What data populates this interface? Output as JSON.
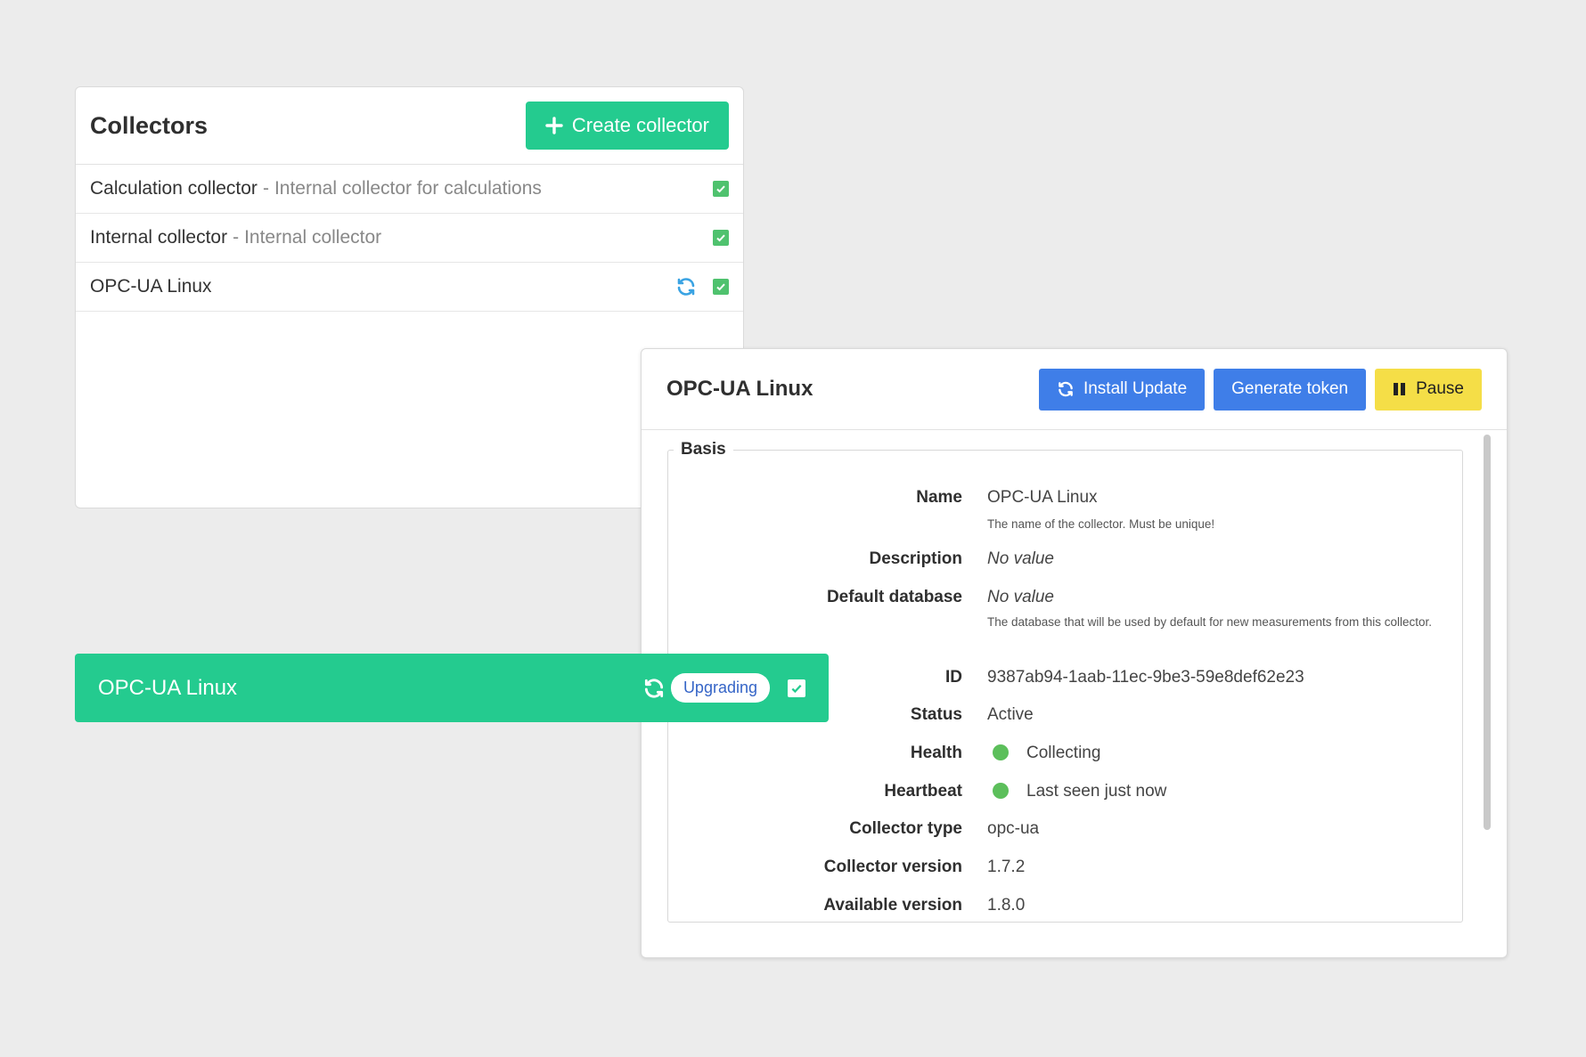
{
  "collectors_panel": {
    "title": "Collectors",
    "create_button": "Create collector",
    "rows": [
      {
        "name": "Calculation collector",
        "separator": "-",
        "description": "Internal collector for calculations"
      },
      {
        "name": "Internal collector",
        "separator": "-",
        "description": "Internal collector"
      },
      {
        "name": "OPC-UA Linux"
      }
    ]
  },
  "detail_panel": {
    "title": "OPC-UA Linux",
    "buttons": {
      "install_update": "Install Update",
      "generate_token": "Generate token",
      "pause": "Pause"
    },
    "section": "Basis",
    "fields": {
      "name": {
        "label": "Name",
        "value": "OPC-UA Linux",
        "help": "The name of the collector. Must be unique!"
      },
      "description": {
        "label": "Description",
        "value": "No value"
      },
      "default_database": {
        "label": "Default database",
        "value": "No value",
        "help": "The database that will be used by default for new measurements from this collector."
      },
      "id": {
        "label": "ID",
        "value": "9387ab94-1aab-11ec-9be3-59e8def62e23"
      },
      "status": {
        "label": "Status",
        "value": "Active"
      },
      "health": {
        "label": "Health",
        "value": "Collecting"
      },
      "heartbeat": {
        "label": "Heartbeat",
        "value": "Last seen just now"
      },
      "collector_type": {
        "label": "Collector type",
        "value": "opc-ua"
      },
      "collector_version": {
        "label": "Collector version",
        "value": "1.7.2"
      },
      "available_version": {
        "label": "Available version",
        "value": "1.8.0"
      }
    }
  },
  "highlight_row": {
    "name": "OPC-UA Linux",
    "badge": "Upgrading"
  },
  "colors": {
    "green": "#24cb8f",
    "blue": "#3f7ee8",
    "yellow": "#f5de47",
    "check_green": "#4fc26e",
    "health_dot": "#5cbf5b"
  }
}
